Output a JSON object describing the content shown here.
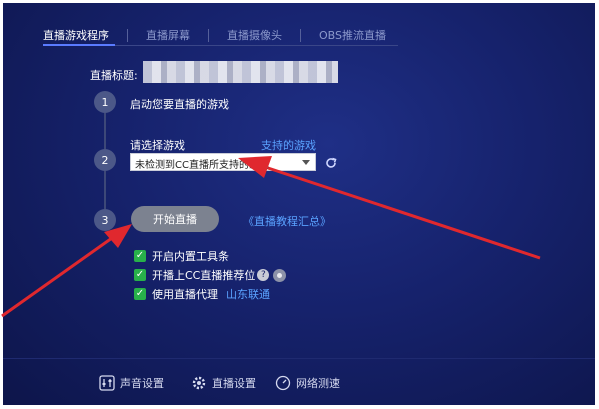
{
  "tabs": [
    {
      "label": "直播游戏程序",
      "active": true
    },
    {
      "label": "直播屏幕",
      "active": false
    },
    {
      "label": "直播摄像头",
      "active": false
    },
    {
      "label": "OBS推流直播",
      "active": false
    }
  ],
  "title": {
    "label": "直播标题:",
    "value_redacted": true
  },
  "steps": {
    "step1": {
      "number": "1",
      "text": "启动您要直播的游戏"
    },
    "step2": {
      "number": "2",
      "label": "请选择游戏",
      "link": "支持的游戏",
      "select_value": "未检测到CC直播所支持的游戏"
    },
    "step3": {
      "number": "3",
      "button": "开始直播",
      "link": "《直播教程汇总》"
    }
  },
  "options": [
    {
      "label": "开启内置工具条",
      "checked": true
    },
    {
      "label": "开播上CC直播推荐位",
      "checked": true
    },
    {
      "label": "使用直播代理",
      "checked": true,
      "value": "山东联通"
    }
  ],
  "bottom": {
    "audio_settings": "声音设置",
    "live_settings": "直播设置",
    "net_speed": "网络测速"
  },
  "icons": {
    "check": "✓",
    "help": "?"
  },
  "colors": {
    "accent_link": "#5aa2ff",
    "checkbox_green": "#28b04a",
    "arrow_red": "#e0282e",
    "panel_bg": "#16226c"
  }
}
